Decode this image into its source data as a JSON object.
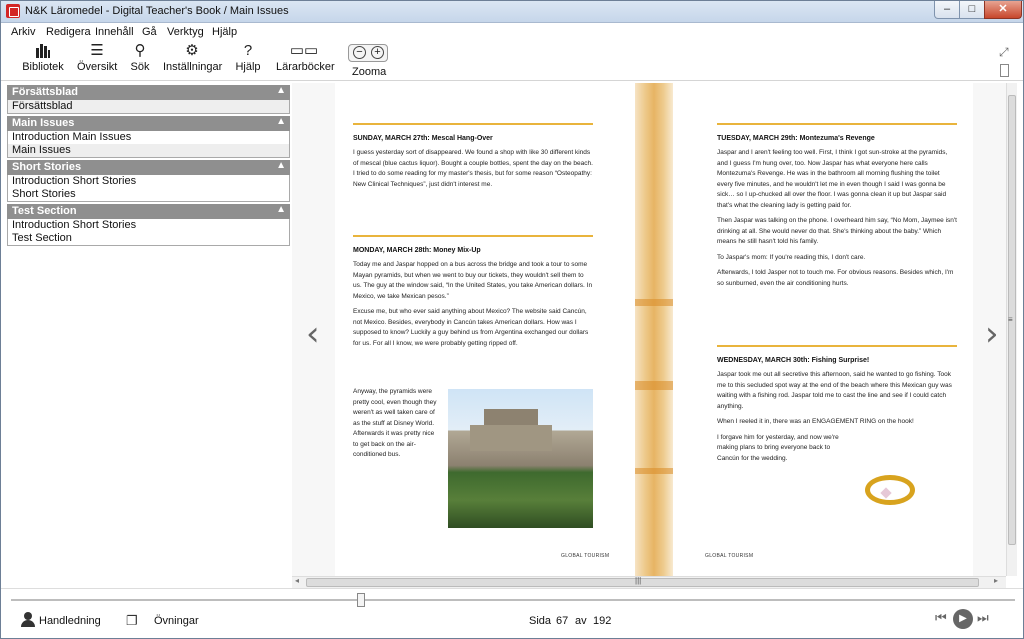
{
  "window": {
    "title": "N&K Läromedel - Digital Teacher's Book / Main Issues",
    "min": "–",
    "max": "□",
    "close": "✕"
  },
  "menu": [
    "Arkiv",
    "Redigera",
    "Innehåll",
    "Gå",
    "Verktyg",
    "Hjälp"
  ],
  "toolbar": {
    "bibliotek": "Bibliotek",
    "oversikt": "Översikt",
    "sok": "Sök",
    "installningar": "Inställningar",
    "hjalp": "Hjälp",
    "lararbocker": "Lärarböcker",
    "zooma": "Zooma",
    "zoom_out": "−",
    "zoom_in": "+"
  },
  "sidebar": [
    {
      "title": "Försättsblad",
      "items": [
        "Försättsblad"
      ]
    },
    {
      "title": "Main Issues",
      "items": [
        "Introduction Main Issues",
        "Main Issues"
      ]
    },
    {
      "title": "Short Stories",
      "items": [
        "Introduction Short Stories",
        "Short Stories"
      ]
    },
    {
      "title": "Test Section",
      "items": [
        "Introduction Short Stories",
        "Test Section"
      ]
    }
  ],
  "pages": {
    "left": {
      "entry1_title": "SUNDAY, MARCH 27th: Mescal Hang-Over",
      "entry1_p1": "I guess yesterday sort of disappeared. We found a shop with like 30 different kinds of mescal (blue cactus liquor). Bought a couple bottles, spent the day on the beach. I tried to do some reading for my master's thesis, but for some reason “Osteopathy: New Clinical Techniques”, just didn't interest me.",
      "entry2_title": "MONDAY, MARCH 28th: Money Mix-Up",
      "entry2_p1": "Today me and Jaspar hopped on a bus across the bridge and took a tour to some Mayan pyramids, but when we went to buy our tickets, they wouldn't sell them to us. The guy at the window said, “In the United States, you take American dollars. In Mexico, we take Mexican pesos.”",
      "entry2_p2": "Excuse me, but who ever said anything about Mexico? The website said Cancún, not Mexico. Besides, everybody in Cancún takes American dollars. How was I supposed to know? Luckily a guy behind us from Argentina exchanged our dollars for us. For all I know, we were probably getting ripped off.",
      "entry2_p3": "Anyway, the pyramids were pretty cool, even though they weren't as well taken care of as the stuff at Disney World. Afterwards it was pretty nice to get back on the air-conditioned bus.",
      "footer": "GLOBAL TOURISM"
    },
    "right": {
      "entry3_title": "TUESDAY, MARCH 29th: Montezuma's Revenge",
      "entry3_p1": "Jaspar and I aren't feeling too well. First, I think I got sun-stroke at the pyramids, and I guess I'm hung over, too. Now Jaspar has what everyone here calls Montezuma's Revenge. He was in the bathroom all morning flushing the toilet every five minutes, and he wouldn't let me in even though I said I was gonna be sick… so I up-chucked all over the floor. I was gonna clean it up but Jaspar said that's what the cleaning lady is getting paid for.",
      "entry3_p2": "Then Jaspar was talking on the phone. I overheard him say, “No Mom, Jaymee isn't drinking at all. She would never do that. She's thinking about the baby.” Which means he still hasn't told his family.",
      "entry3_p3": "To Jaspar's mom: If you're reading this, I don't care.",
      "entry3_p4": "Afterwards, I told Jasper not to touch me. For obvious reasons. Besides which, I'm so sunburned, even the air conditioning hurts.",
      "entry4_title": "WEDNESDAY, MARCH 30th: Fishing Surprise!",
      "entry4_p1": "Jaspar took me out all secretive this afternoon, said he wanted to go fishing. Took me to this secluded spot way at the end of the beach where this Mexican guy was waiting with a fishing rod. Jaspar told me to cast the line and see if I could catch anything.",
      "entry4_p2": "When I reeled it in, there was an ENGAGEMENT RING on the hook!",
      "entry4_p3": "I forgave him for yesterday, and now we're making plans to bring everyone back to Cancún for the wedding.",
      "footer": "GLOBAL TOURISM"
    }
  },
  "bottombar": {
    "handledning": "Handledning",
    "ovningar": "Övningar",
    "sida_label": "Sida",
    "page_current": "67",
    "av_label": "av",
    "page_total": "192",
    "page_progress": 0.349
  }
}
